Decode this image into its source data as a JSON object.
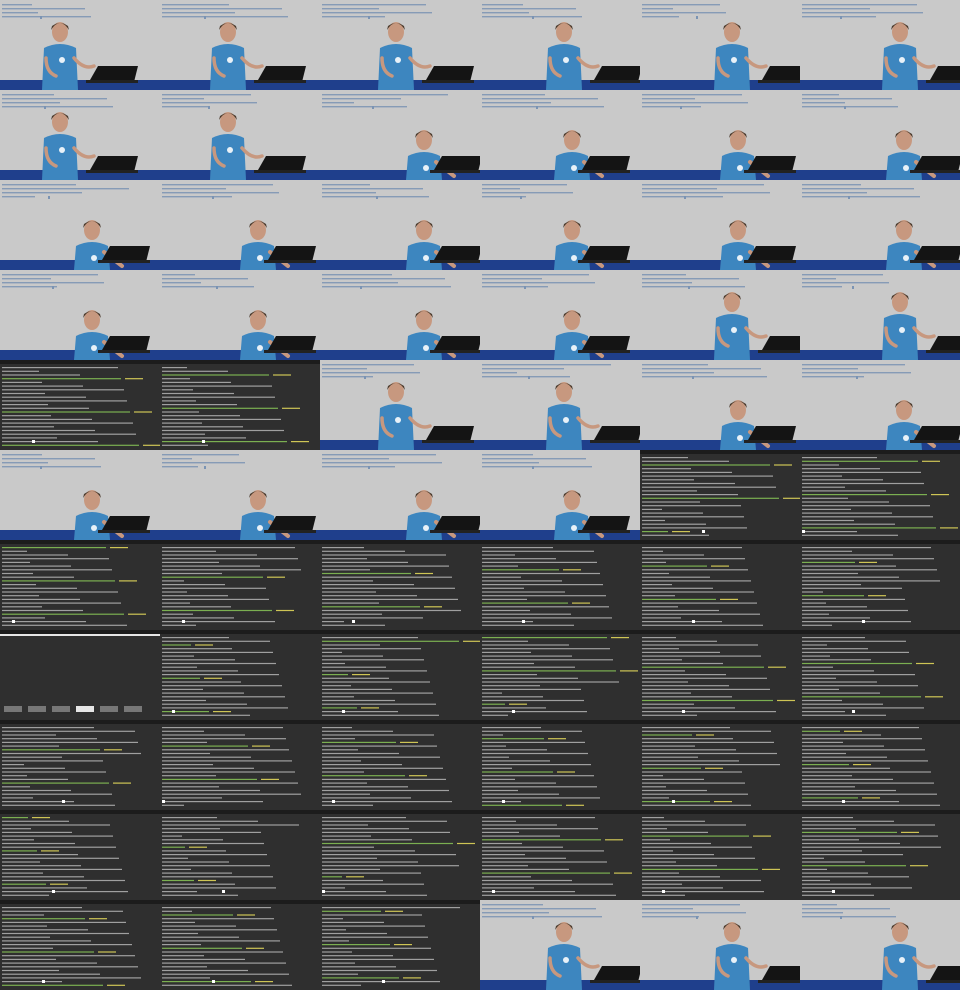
{
  "contact_sheet": {
    "columns": 6,
    "rows": 11,
    "frames": [
      "presenter",
      "presenter",
      "presenter",
      "presenter",
      "presenter",
      "presenter",
      "presenter",
      "presenter",
      "presenter-typing",
      "presenter-typing",
      "presenter-typing",
      "presenter-typing",
      "presenter-typing",
      "presenter-typing",
      "presenter-typing",
      "presenter-typing",
      "presenter-typing",
      "presenter-typing",
      "presenter-typing",
      "presenter-typing",
      "presenter-typing",
      "presenter-typing",
      "presenter",
      "presenter",
      "terminal",
      "terminal",
      "presenter",
      "presenter",
      "presenter-typing",
      "presenter-typing",
      "presenter-typing",
      "presenter-typing",
      "presenter-typing",
      "presenter-typing",
      "terminal",
      "terminal",
      "terminal",
      "terminal",
      "terminal",
      "terminal",
      "terminal",
      "terminal",
      "terminal-menu",
      "terminal",
      "terminal",
      "terminal",
      "terminal",
      "terminal",
      "terminal",
      "terminal",
      "terminal",
      "terminal",
      "terminal",
      "terminal",
      "terminal",
      "terminal",
      "terminal",
      "terminal",
      "terminal",
      "terminal",
      "terminal",
      "terminal",
      "terminal",
      "presenter",
      "presenter",
      "presenter"
    ]
  },
  "colors": {
    "wall": "#c9c9c9",
    "screen_text": "#7a93b3",
    "shirt": "#3d86bf",
    "skin": "#c7987f",
    "hair": "#4a3a2c",
    "laptop": "#141414",
    "desk_blue": "#1f3f8c",
    "terminal_bg": "#2f2f2f",
    "terminal_text": "#bdbdbd",
    "terminal_green": "#8fcf5a"
  }
}
